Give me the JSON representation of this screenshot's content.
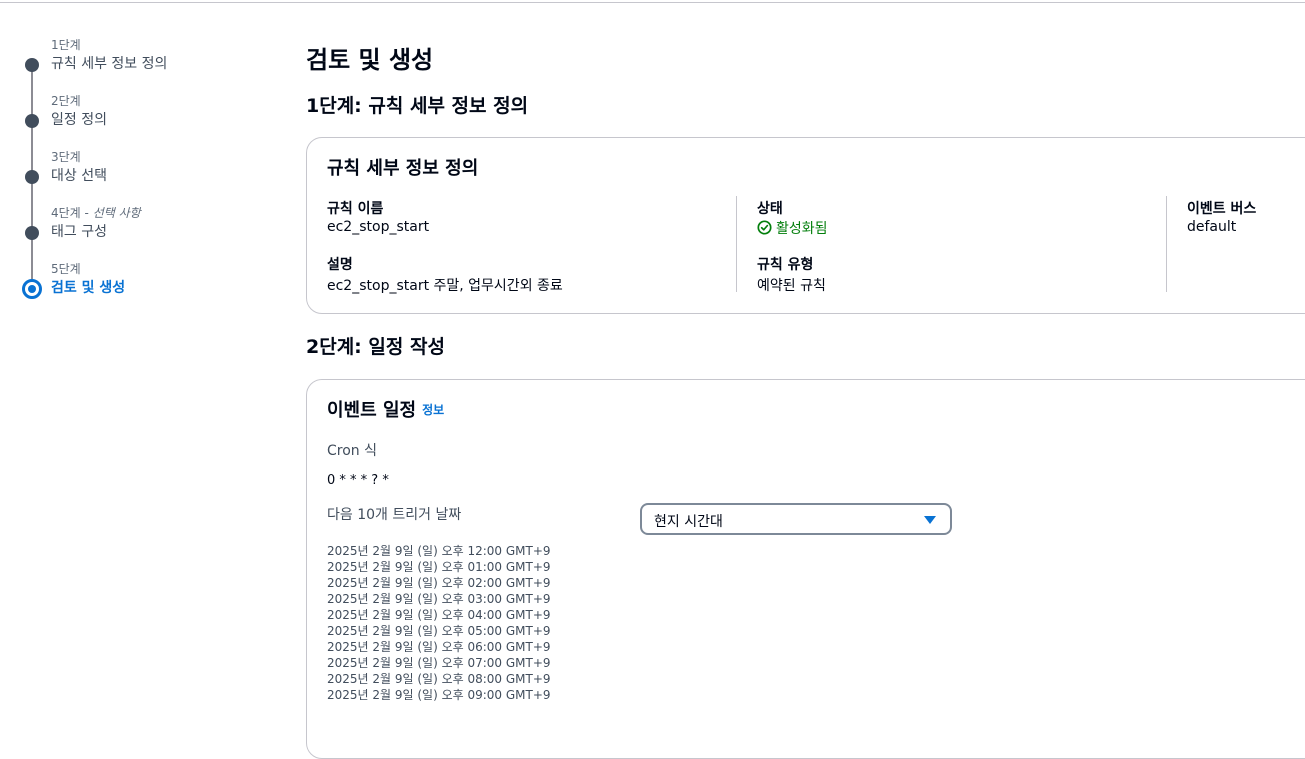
{
  "nav": {
    "steps": [
      {
        "num": "1단계",
        "label": "규칙 세부 정보 정의"
      },
      {
        "num": "2단계",
        "label": "일정 정의"
      },
      {
        "num": "3단계",
        "label": "대상 선택"
      },
      {
        "num": "4단계",
        "optional": "선택 사항",
        "label": "태그 구성"
      },
      {
        "num": "5단계",
        "label": "검토 및 생성"
      }
    ]
  },
  "page_title": "검토 및 생성",
  "section1": {
    "title": "1단계: 규칙 세부 정보 정의",
    "card_title": "규칙 세부 정보 정의",
    "rule_name_label": "규칙 이름",
    "rule_name_value": "ec2_stop_start",
    "description_label": "설명",
    "description_value": "ec2_stop_start 주말, 업무시간외 종료",
    "status_label": "상태",
    "status_value": "활성화됨",
    "status_color": "#037f0c",
    "rule_type_label": "규칙 유형",
    "rule_type_value": "예약된 규칙",
    "event_bus_label": "이벤트 버스",
    "event_bus_value": "default"
  },
  "section2": {
    "title": "2단계: 일정 작성",
    "card_title": "이벤트 일정",
    "info_link": "정보",
    "cron_label": "Cron 식",
    "cron_value": "0 * * * ? *",
    "next_triggers_label": "다음 10개 트리거 날짜",
    "timezone_select": "현지 시간대",
    "trigger_dates": [
      "2025년 2월 9일 (일) 오후 12:00 GMT+9",
      "2025년 2월 9일 (일) 오후 01:00 GMT+9",
      "2025년 2월 9일 (일) 오후 02:00 GMT+9",
      "2025년 2월 9일 (일) 오후 03:00 GMT+9",
      "2025년 2월 9일 (일) 오후 04:00 GMT+9",
      "2025년 2월 9일 (일) 오후 05:00 GMT+9",
      "2025년 2월 9일 (일) 오후 06:00 GMT+9",
      "2025년 2월 9일 (일) 오후 07:00 GMT+9",
      "2025년 2월 9일 (일) 오후 08:00 GMT+9",
      "2025년 2월 9일 (일) 오후 09:00 GMT+9"
    ]
  },
  "colors": {
    "accent": "#0972d3",
    "success": "#037f0c",
    "text": "#000716",
    "border": "#c6c6cd"
  }
}
